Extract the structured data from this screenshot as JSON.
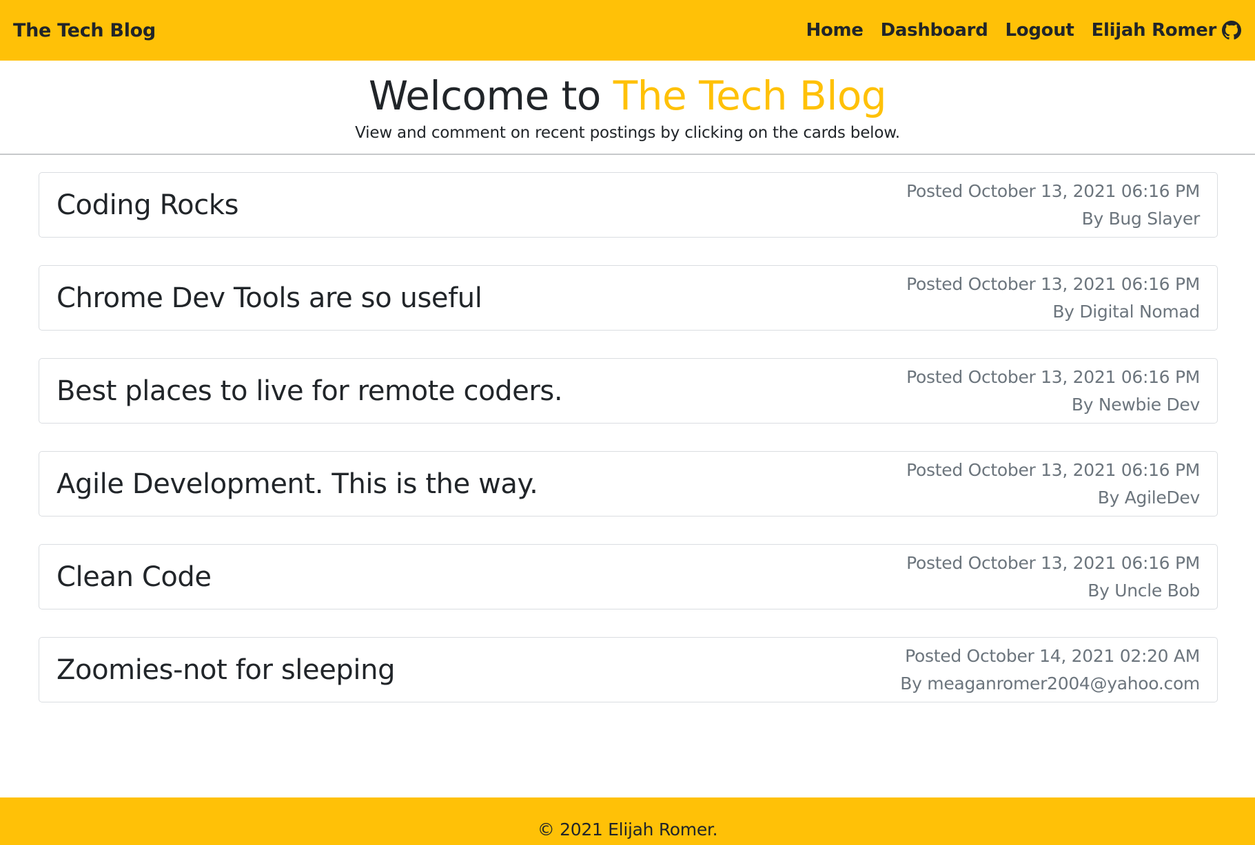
{
  "navbar": {
    "brand": "The Tech Blog",
    "links": {
      "home": "Home",
      "dashboard": "Dashboard",
      "logout": "Logout",
      "user": "Elijah Romer"
    },
    "user_icon": "github-icon",
    "background_color": "#ffc107"
  },
  "hero": {
    "title_prefix": "Welcome to ",
    "title_accent": "The Tech Blog",
    "subtitle": "View and comment on recent postings by clicking on the cards below.",
    "accent_color": "#ffc107"
  },
  "posts": [
    {
      "title": "Coding Rocks",
      "posted": "Posted October 13, 2021 06:16 PM",
      "author": "By Bug Slayer"
    },
    {
      "title": "Chrome Dev Tools are so useful",
      "posted": "Posted October 13, 2021 06:16 PM",
      "author": "By Digital Nomad"
    },
    {
      "title": "Best places to live for remote coders.",
      "posted": "Posted October 13, 2021 06:16 PM",
      "author": "By Newbie Dev"
    },
    {
      "title": "Agile Development. This is the way.",
      "posted": "Posted October 13, 2021 06:16 PM",
      "author": "By AgileDev"
    },
    {
      "title": "Clean Code",
      "posted": "Posted October 13, 2021 06:16 PM",
      "author": "By Uncle Bob"
    },
    {
      "title": "Zoomies-not for sleeping",
      "posted": "Posted October 14, 2021 02:20 AM",
      "author": "By meaganromer2004@yahoo.com"
    }
  ],
  "footer": {
    "text": "© 2021 Elijah Romer."
  }
}
